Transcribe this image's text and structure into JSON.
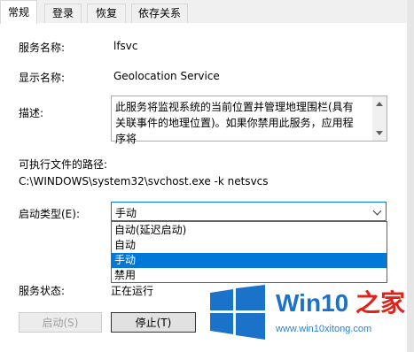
{
  "tabs": [
    {
      "label": "常规",
      "active": true
    },
    {
      "label": "登录",
      "active": false
    },
    {
      "label": "恢复",
      "active": false
    },
    {
      "label": "依存关系",
      "active": false
    }
  ],
  "fields": {
    "service_name_label": "服务名称:",
    "service_name_value": "lfsvc",
    "display_name_label": "显示名称:",
    "display_name_value": "Geolocation Service",
    "description_label": "描述:",
    "description_value": "此服务将监视系统的当前位置并管理地理围栏(具有关联事件的地理位置)。如果你禁用此服务，应用程序将",
    "path_label": "可执行文件的路径:",
    "path_value": "C:\\WINDOWS\\system32\\svchost.exe -k netsvcs",
    "startup_type_label": "启动类型(E):",
    "startup_type_value": "手动",
    "service_status_label": "服务状态:",
    "service_status_value": "正在运行"
  },
  "startup_options": [
    {
      "label": "自动(延迟启动)",
      "selected": false
    },
    {
      "label": "自动",
      "selected": false
    },
    {
      "label": "手动",
      "selected": true
    },
    {
      "label": "禁用",
      "selected": false
    }
  ],
  "buttons": {
    "start": "启动(S)",
    "stop": "停止(T)"
  },
  "watermark": {
    "brand_prefix": "Win10",
    "brand_suffix": " 之家",
    "url": "www.win10xitong.com",
    "colors": {
      "blue": "#1b73c9",
      "red": "#e0231a"
    }
  }
}
